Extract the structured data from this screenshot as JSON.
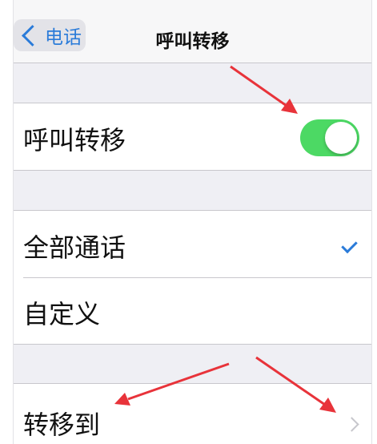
{
  "nav": {
    "back_label": "电话",
    "title": "呼叫转移"
  },
  "call_forwarding": {
    "label": "呼叫转移",
    "enabled": true
  },
  "forward_options": {
    "all_calls_label": "全部通话",
    "all_calls_selected": true,
    "custom_label": "自定义"
  },
  "forward_to": {
    "label": "转移到"
  },
  "colors": {
    "accent": "#2a7bd9",
    "toggle_on": "#4cd964",
    "annotation_arrow": "#e8333a",
    "grouped_background": "#efeff4"
  },
  "icons": [
    "back-chevron-icon",
    "checkmark-icon",
    "disclosure-chevron-icon"
  ]
}
